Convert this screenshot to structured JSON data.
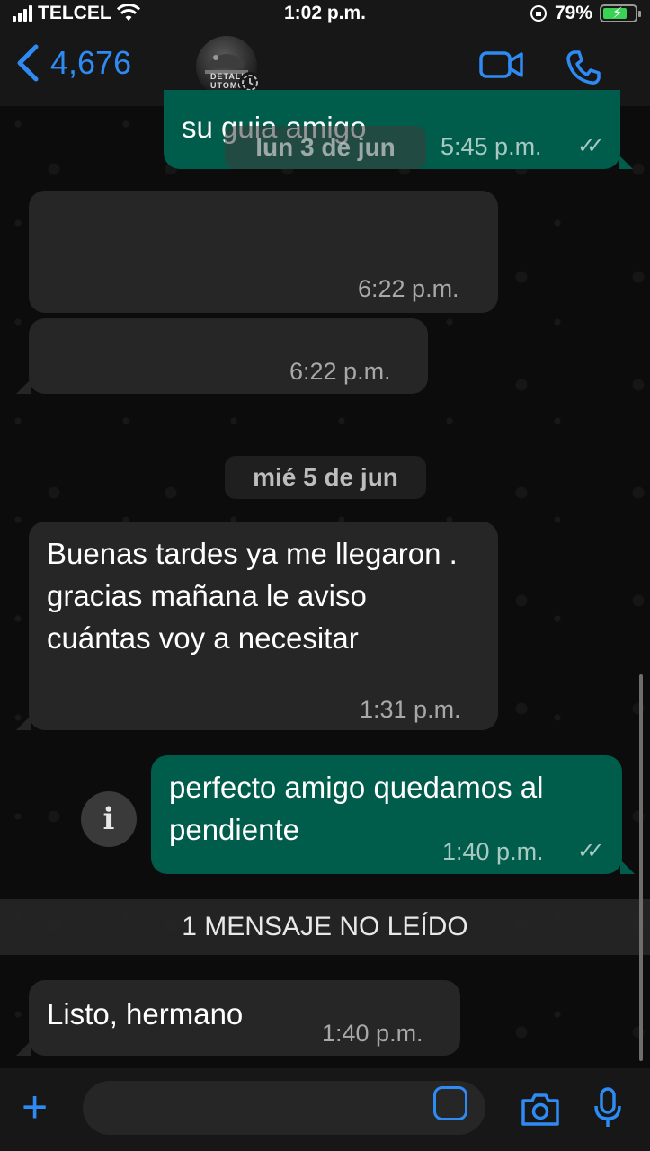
{
  "status_bar": {
    "carrier": "TELCEL",
    "time": "1:02 p.m.",
    "battery_percent": "79%",
    "battery_level": 0.79
  },
  "header": {
    "back_count": "4,676",
    "avatar_text": "DETALL\nUTOMC",
    "accent_color": "#2e8bf3"
  },
  "messages": [
    {
      "direction": "out",
      "text": "su guia amigo",
      "time": "5:45 p.m.",
      "status": "read"
    },
    {
      "direction": "date",
      "text": "lun 3 de jun"
    },
    {
      "direction": "in",
      "text": "",
      "time": "6:22 p.m."
    },
    {
      "direction": "in",
      "text": "",
      "time": "6:22 p.m."
    },
    {
      "direction": "date",
      "text": "mié 5 de jun"
    },
    {
      "direction": "in",
      "text": "Buenas tardes ya me llegaron . gracias mañana le aviso cuántas voy a necesitar",
      "time": "1:31 p.m."
    },
    {
      "direction": "out",
      "text": "perfecto amigo quedamos al pendiente",
      "time": "1:40 p.m.",
      "status": "read"
    },
    {
      "direction": "in",
      "text": "Listo, hermano",
      "time": "1:40 p.m."
    }
  ],
  "unread_banner": "1 MENSAJE NO LEÍDO",
  "info_icon_label": "i",
  "icons": {
    "back": "chevron-left-icon",
    "video": "video-camera-icon",
    "call": "phone-icon",
    "attach": "plus-icon",
    "sticker": "sticker-icon",
    "camera": "camera-icon",
    "mic": "microphone-icon"
  },
  "colors": {
    "incoming_bubble": "#262626",
    "outgoing_bubble": "#005c4b",
    "battery_fill": "#39d353"
  }
}
